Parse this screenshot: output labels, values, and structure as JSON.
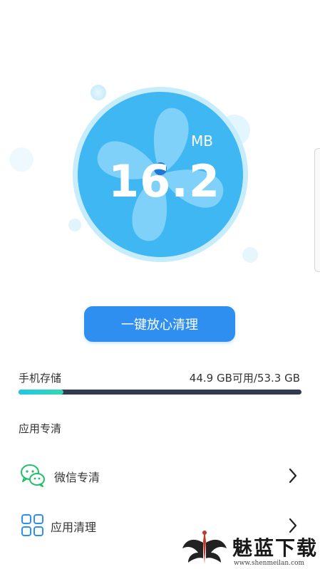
{
  "cleaner": {
    "junk_value": "16.2",
    "junk_unit": "MB"
  },
  "actions": {
    "clean_button_label": "一键放心清理"
  },
  "storage": {
    "label": "手机存储",
    "summary": "44.9 GB可用/53.3 GB",
    "used_fraction": 0.158
  },
  "section": {
    "title": "应用专清"
  },
  "items": [
    {
      "label": "微信专清",
      "icon": "wechat-icon"
    },
    {
      "label": "应用清理",
      "icon": "app-grid-icon"
    }
  ],
  "watermark": {
    "brand": "魅蓝下载",
    "url": "www.shenmeilan.com"
  },
  "colors": {
    "accent": "#2f8ff0",
    "fan_circle": "#3fb7f3",
    "wechat_green": "#21c06a",
    "apps_blue": "#2f8ff0",
    "track": "#323a4f"
  }
}
